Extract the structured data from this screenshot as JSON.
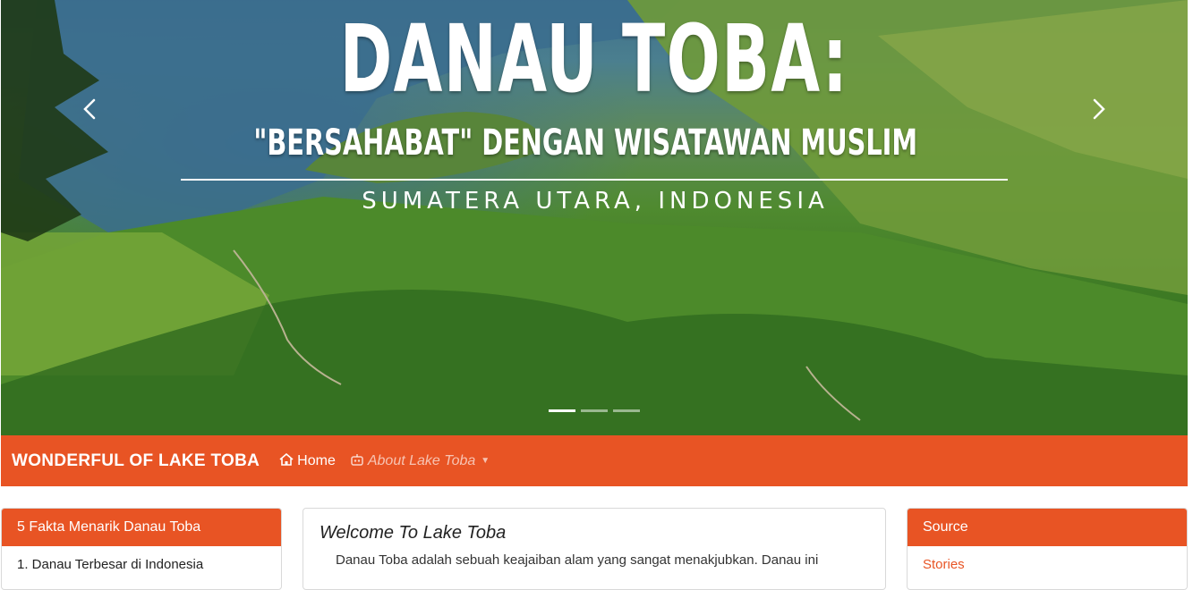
{
  "carousel": {
    "title": "DANAU TOBA:",
    "subtitle": "\"BERSAHABAT\" DENGAN WISATAWAN MUSLIM",
    "location": "SUMATERA UTARA, INDONESIA",
    "prev_icon": "chevron-left-icon",
    "next_icon": "chevron-right-icon",
    "slide_count": 3,
    "active_slide": 1
  },
  "navbar": {
    "brand": "WONDERFUL OF LAKE TOBA",
    "items": [
      {
        "label": "Home",
        "icon": "home-icon"
      },
      {
        "label": "About Lake Toba",
        "icon": "robot-icon"
      }
    ],
    "accent_color": "#e85424"
  },
  "left_panel": {
    "header": "5 Fakta Menarik Danau Toba",
    "items": [
      "1. Danau Terbesar di Indonesia"
    ]
  },
  "main": {
    "heading": "Welcome To Lake Toba",
    "paragraph": "Danau Toba adalah sebuah keajaiban alam yang sangat menakjubkan. Danau ini"
  },
  "right_panel": {
    "header": "Source",
    "links": [
      "Stories"
    ]
  }
}
